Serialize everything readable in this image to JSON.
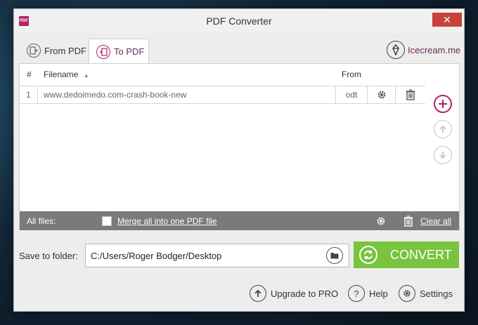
{
  "window": {
    "title": "PDF Converter",
    "close_glyph": "✕",
    "app_icon_text": "PDF"
  },
  "tabs": [
    {
      "label": "From PDF",
      "icon": "pdf-out-icon"
    },
    {
      "label": "To PDF",
      "icon": "pdf-in-icon"
    }
  ],
  "brand": {
    "label": "Icecream.me",
    "icon": "icecream-logo-icon"
  },
  "table": {
    "columns": [
      "#",
      "Filename",
      "From"
    ],
    "rows": [
      {
        "num": "1",
        "filename": "www.dedoimedo.com-crash-book-new",
        "from": "odt"
      }
    ]
  },
  "footer": {
    "all_files_label": "All files:",
    "merge_label": "Merge all into one PDF file",
    "merge_checked": false,
    "clear_all_label": "Clear all"
  },
  "save": {
    "label": "Save to folder:",
    "path": "C:/Users/Roger Bodger/Desktop"
  },
  "convert": {
    "label": "CONVERT"
  },
  "bottom": {
    "upgrade_label": "Upgrade to PRO",
    "help_label": "Help",
    "settings_label": "Settings"
  },
  "colors": {
    "accent": "#b02262",
    "convert": "#79c33f",
    "footer_bar": "#7a7a7a"
  }
}
